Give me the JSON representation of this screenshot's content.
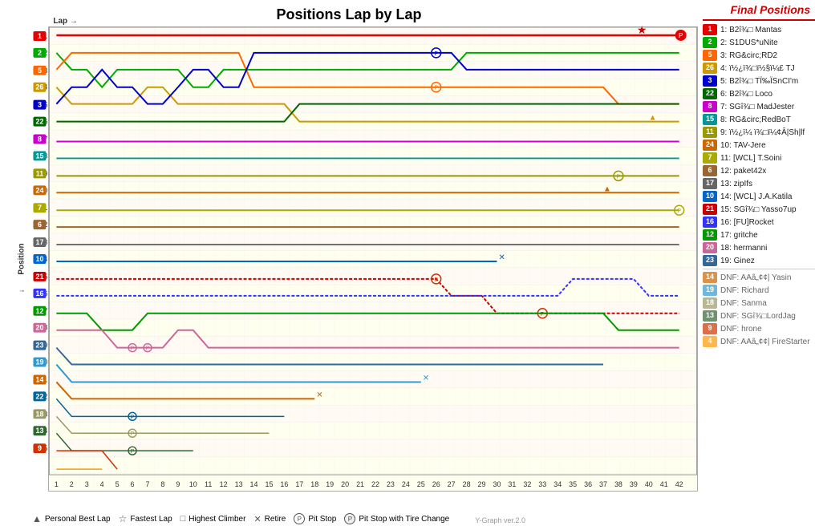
{
  "title": "Positions Lap by Lap",
  "xAxis": {
    "label": "Lap",
    "ticks": [
      "1",
      "2",
      "3",
      "4",
      "5",
      "6",
      "7",
      "8",
      "9",
      "10",
      "11",
      "12",
      "13",
      "14",
      "15",
      "16",
      "17",
      "18",
      "19",
      "20",
      "21",
      "22",
      "23",
      "24",
      "25",
      "26",
      "27",
      "28",
      "29",
      "30",
      "31",
      "32",
      "33",
      "34",
      "35",
      "36",
      "37",
      "38",
      "39",
      "40",
      "41",
      "42"
    ]
  },
  "yAxis": {
    "label": "Position",
    "ticks": [
      "1",
      "2",
      "3",
      "4",
      "5",
      "6",
      "7",
      "8",
      "9",
      "10",
      "11",
      "12",
      "13",
      "14",
      "15",
      "16",
      "17",
      "18",
      "19",
      "20",
      "21",
      "22",
      "23",
      "24",
      "25"
    ]
  },
  "finalPositions": {
    "title": "Final Positions",
    "entries": [
      {
        "pos": "1",
        "color": "#e60000",
        "name": "B2î¾□ Mantas"
      },
      {
        "pos": "2",
        "color": "#00aa00",
        "name": "S1DUS*uNite"
      },
      {
        "pos": "5",
        "color": "#ff6600",
        "name": "RG&circ;RD2"
      },
      {
        "pos": "26",
        "color": "#cc9900",
        "name": "ï½¿ï¾□ï½§ï¼£ TJ"
      },
      {
        "pos": "3",
        "color": "#0000cc",
        "name": "B2î¾□ TÏ‰ÏSnCI'm"
      },
      {
        "pos": "22",
        "color": "#006600",
        "name": "B2î¾□ Loco"
      },
      {
        "pos": "8",
        "color": "#cc00cc",
        "name": "SGî¾□ MadJester"
      },
      {
        "pos": "15",
        "color": "#009999",
        "name": "RG&circ;RedBoT"
      },
      {
        "pos": "11",
        "color": "#999900",
        "name": "ï½¿ï¼ ï¾□ï¼¢Â|Sh|lf"
      },
      {
        "pos": "24",
        "color": "#cc6600",
        "name": "TAV-Jere"
      },
      {
        "pos": "7",
        "color": "#aaaa00",
        "name": "[WCL] T.Soini"
      },
      {
        "pos": "6",
        "color": "#996633",
        "name": "paket42x"
      },
      {
        "pos": "17",
        "color": "#666666",
        "name": "zipIfs"
      },
      {
        "pos": "10",
        "color": "#0066cc",
        "name": "[WCL] J.A.Katila"
      },
      {
        "pos": "21",
        "color": "#cc0000",
        "name": "SGî¾□ Yasso7up"
      },
      {
        "pos": "16",
        "color": "#3333ff",
        "name": "[FU]Rocket"
      },
      {
        "pos": "12",
        "color": "#009900",
        "name": "gritche"
      },
      {
        "pos": "20",
        "color": "#cc6699",
        "name": "hermanni"
      },
      {
        "pos": "23",
        "color": "#336699",
        "name": "Ginez"
      }
    ],
    "dnfEntries": [
      {
        "pos": "14",
        "color": "#cc6600",
        "name": "DNF: AAâ„¢¢| Yasin"
      },
      {
        "pos": "19",
        "color": "#3399cc",
        "name": "DNF: Richard"
      },
      {
        "pos": "18",
        "color": "#999966",
        "name": "DNF: Sanma"
      },
      {
        "pos": "13",
        "color": "#336633",
        "name": "DNF: SGî¾□LordJag"
      },
      {
        "pos": "9",
        "color": "#cc3300",
        "name": "DNF: hrone"
      },
      {
        "pos": "4",
        "color": "#ff9900",
        "name": "DNF: AAâ„¢¢| FireStarter"
      }
    ]
  },
  "legend": {
    "items": [
      {
        "symbol": "▲",
        "label": "Personal Best Lap"
      },
      {
        "symbol": "☆",
        "label": "Fastest Lap"
      },
      {
        "symbol": "□",
        "label": "Highest Climber"
      },
      {
        "symbol": "✕",
        "label": "Retire"
      },
      {
        "symbol": "Ⓟ",
        "label": "Pit Stop"
      },
      {
        "symbol": "Ⓟ",
        "label": "Pit Stop with Tire Change"
      }
    ]
  },
  "version": "Y-Graph ver.2.0"
}
